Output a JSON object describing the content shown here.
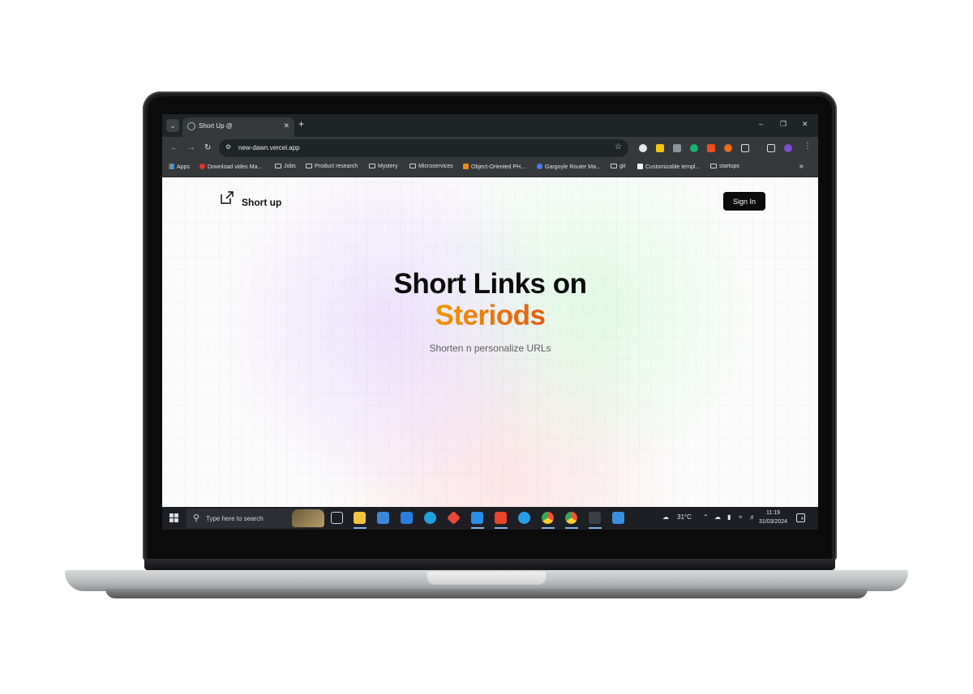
{
  "browser": {
    "tab_title": "Short Up @",
    "url": "new-dawn.vercel.app",
    "bookmarks": [
      "Apps",
      "Download video Ma...",
      "Jobs",
      "Product research",
      "Mystery",
      "Microservices",
      "Object-Oriented PH...",
      "Gargoyle Router Ma...",
      "git",
      "Customizable templ...",
      "startups"
    ]
  },
  "page": {
    "brand": "Short up",
    "signin_label": "Sign In",
    "hero_line1": "Short Links on",
    "hero_line2": "Steriods",
    "subtitle": "Shorten n personalize URLs"
  },
  "taskbar": {
    "search_placeholder": "Type here to search",
    "temperature": "31°C",
    "time": "11:19",
    "date": "31/03/2024",
    "notification_count": "4"
  },
  "colors": {
    "accent_gradient_start": "#f29700",
    "accent_gradient_end": "#e25c13",
    "browser_dark": "#35393b",
    "taskbar": "#1e1f24"
  }
}
